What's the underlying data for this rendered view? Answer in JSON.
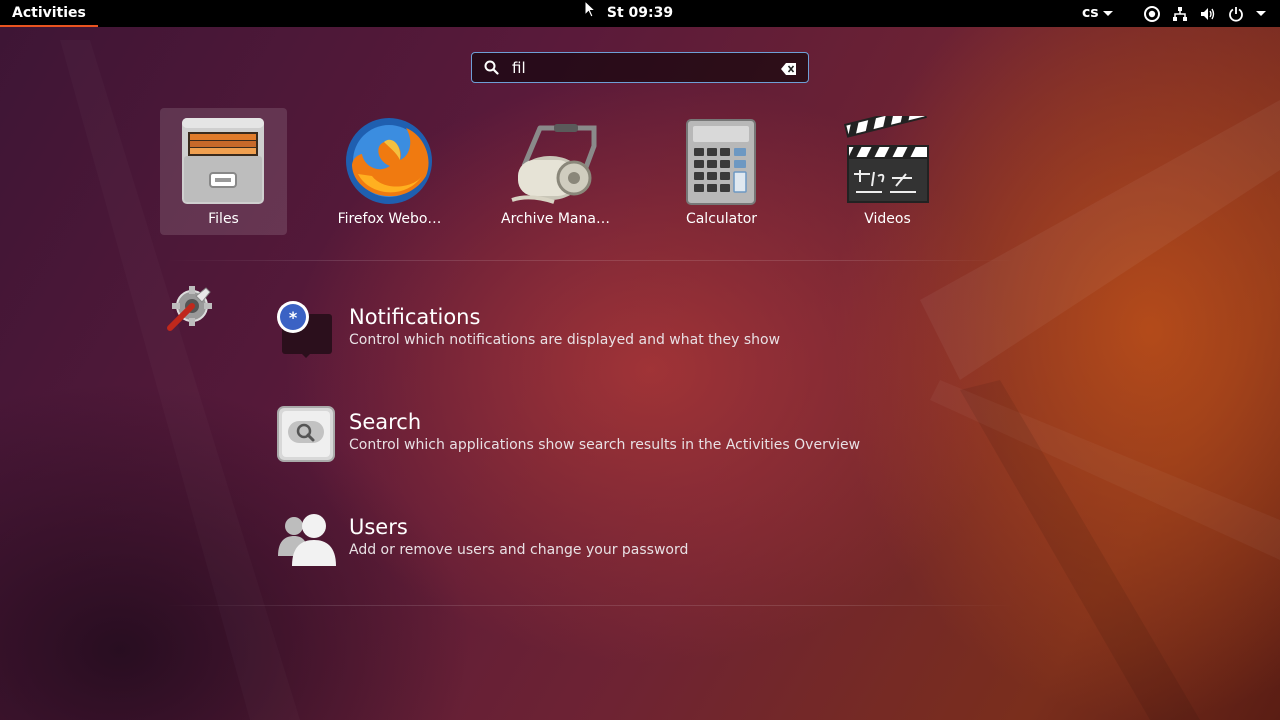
{
  "topbar": {
    "activities": "Activities",
    "clock": "St 09:39",
    "language": "cs",
    "tray_icons": [
      "accessibility-icon",
      "network-icon",
      "volume-icon",
      "power-icon"
    ]
  },
  "search": {
    "value": "fil"
  },
  "apps": [
    {
      "label": "Files",
      "icon": "file-cabinet-icon",
      "selected": true
    },
    {
      "label": "Firefox Webo…",
      "icon": "firefox-icon"
    },
    {
      "label": "Archive Mana…",
      "icon": "archive-roller-icon"
    },
    {
      "label": "Calculator",
      "icon": "calculator-icon"
    },
    {
      "label": "Videos",
      "icon": "clapperboard-icon"
    }
  ],
  "settings_results": {
    "provider_icon": "settings-wrench-gear-icon",
    "items": [
      {
        "title": "Notifications",
        "description": "Control which notifications are displayed and what they show",
        "icon": "notifications-icon"
      },
      {
        "title": "Search",
        "description": "Control which applications show search results in the Activities Overview",
        "icon": "search-settings-icon"
      },
      {
        "title": "Users",
        "description": "Add or remove users and change your password",
        "icon": "users-icon"
      }
    ]
  },
  "colors": {
    "accent": "#e95420",
    "search_border": "#6e9fd6",
    "panel": "#000000"
  }
}
